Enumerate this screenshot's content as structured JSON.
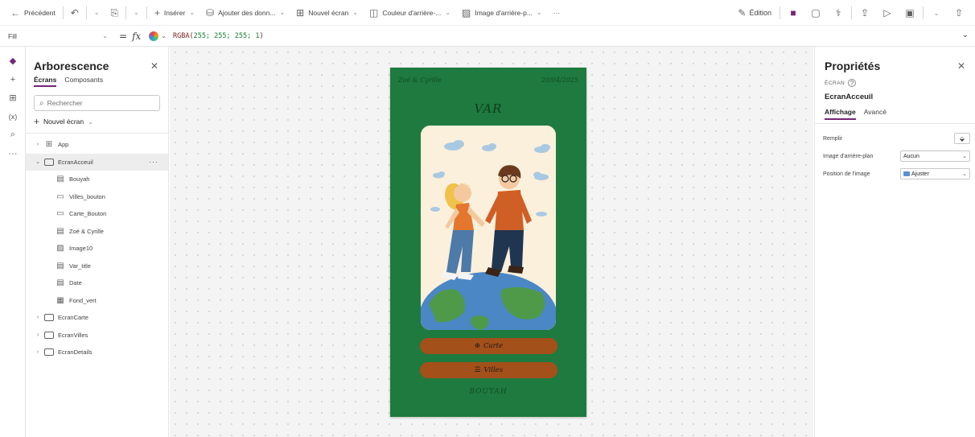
{
  "toolbar": {
    "back_label": "Précédent",
    "insert_label": "Insérer",
    "add_data_label": "Ajouter des donn...",
    "new_screen_label": "Nouvel écran",
    "bg_color_label": "Couleur d'arrière-...",
    "bg_image_label": "Image d'arrière-p...",
    "more_label": "···",
    "edit_label": "Édition"
  },
  "formula": {
    "property": "Fill",
    "expression_prefix": "RGBA(",
    "expression_args": "255; 255; 255; 1",
    "expression_suffix": ")"
  },
  "tree": {
    "title": "Arborescence",
    "tabs": [
      "Écrans",
      "Composants"
    ],
    "search_placeholder": "Rechercher",
    "new_screen": "Nouvel écran",
    "items": [
      {
        "label": "App",
        "level": 0,
        "icon": "app-grid-icon",
        "expanded": false
      },
      {
        "label": "EcranAcceuil",
        "level": 0,
        "icon": "screen-icon",
        "expanded": true
      },
      {
        "label": "Bouyah",
        "level": 1,
        "icon": "label-icon"
      },
      {
        "label": "Villes_bouton",
        "level": 1,
        "icon": "button-icon"
      },
      {
        "label": "Carte_Bouton",
        "level": 1,
        "icon": "button-icon"
      },
      {
        "label": "Zoé & Cyrille",
        "level": 1,
        "icon": "label-icon"
      },
      {
        "label": "Image10",
        "level": 1,
        "icon": "image-icon"
      },
      {
        "label": "Var_title",
        "level": 1,
        "icon": "label-icon"
      },
      {
        "label": "Date",
        "level": 1,
        "icon": "label-icon"
      },
      {
        "label": "Fond_vert",
        "level": 1,
        "icon": "rectangle-icon"
      },
      {
        "label": "EcranCarte",
        "level": 0,
        "icon": "screen-icon",
        "expanded": false
      },
      {
        "label": "EcranVilles",
        "level": 0,
        "icon": "screen-icon",
        "expanded": false
      },
      {
        "label": "EcranDetails",
        "level": 0,
        "icon": "screen-icon",
        "expanded": false
      }
    ]
  },
  "phone": {
    "top_left": "Zoé & Cyrille",
    "date": "20/04/2025",
    "heading": "VAR",
    "btn_map": "Carte",
    "btn_cities": "Villes",
    "footer": "BOUYAH",
    "bg_color": "#1f7a3f",
    "btn_color": "#a4501a"
  },
  "props": {
    "title": "Propriétés",
    "kind": "ÉCRAN",
    "name": "EcranAcceuil",
    "tabs": [
      "Affichage",
      "Avancé"
    ],
    "fill_label": "Remplir",
    "bg_image_label": "Image d'arrière-plan",
    "bg_image_value": "Aucun",
    "image_position_label": "Position de l'image",
    "image_position_value": "Ajuster"
  }
}
